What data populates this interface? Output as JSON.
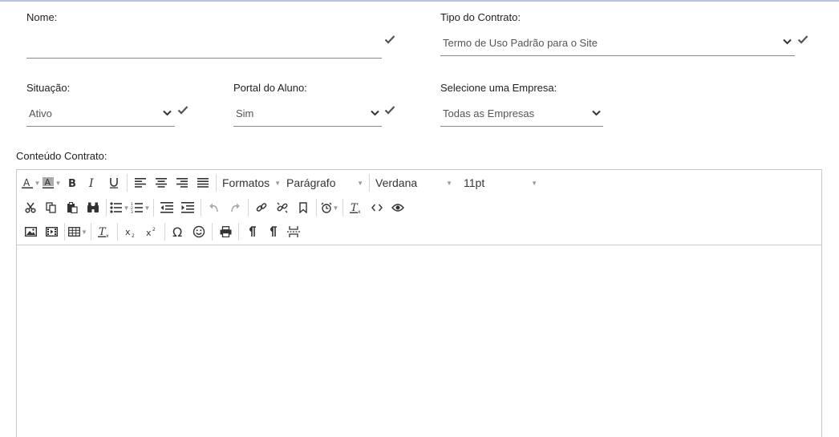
{
  "form": {
    "nome": {
      "label": "Nome:",
      "value": ""
    },
    "tipo_contrato": {
      "label": "Tipo do Contrato:",
      "value": "Termo de Uso Padrão para o Site"
    },
    "situacao": {
      "label": "Situação:",
      "value": "Ativo"
    },
    "portal_aluno": {
      "label": "Portal do Aluno:",
      "value": "Sim"
    },
    "empresa": {
      "label": "Selecione uma Empresa:",
      "value": "Todas as Empresas"
    },
    "conteudo": {
      "label": "Conteúdo Contrato:"
    }
  },
  "toolbar": {
    "formatos": "Formatos",
    "paragrafo": "Parágrafo",
    "fonte": "Verdana",
    "tamanho": "11pt"
  },
  "colors": {
    "check": "#555555",
    "border": "#c9c9c9",
    "underline": "#8a8a8a"
  }
}
